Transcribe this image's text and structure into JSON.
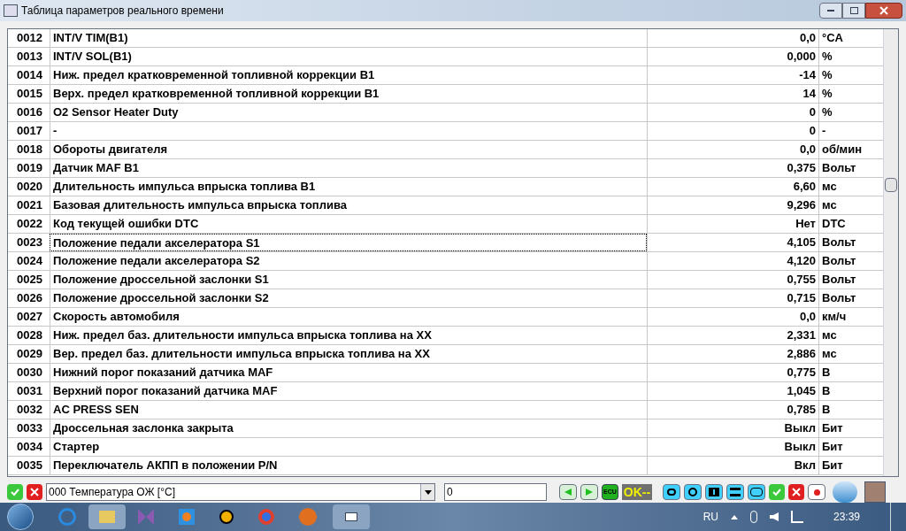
{
  "window": {
    "title": "Таблица параметров реального времени"
  },
  "table": {
    "rows": [
      {
        "id": "0012",
        "name": "INT/V TIM(B1)",
        "value": "0,0",
        "unit": "°CA",
        "focused": false
      },
      {
        "id": "0013",
        "name": "INT/V SOL(B1)",
        "value": "0,000",
        "unit": "%",
        "focused": false
      },
      {
        "id": "0014",
        "name": "Ниж. предел кратковременной топливной коррекции B1",
        "value": "-14",
        "unit": "%",
        "focused": false
      },
      {
        "id": "0015",
        "name": "Верх. предел кратковременной топливной коррекции B1",
        "value": "14",
        "unit": "%",
        "focused": false
      },
      {
        "id": "0016",
        "name": "O2 Sensor Heater Duty",
        "value": "0",
        "unit": "%",
        "focused": false
      },
      {
        "id": "0017",
        "name": "-",
        "value": "0",
        "unit": "-",
        "focused": false
      },
      {
        "id": "0018",
        "name": "Обороты двигателя",
        "value": "0,0",
        "unit": "об/мин",
        "focused": false
      },
      {
        "id": "0019",
        "name": "Датчик MAF B1",
        "value": "0,375",
        "unit": "Вольт",
        "focused": false
      },
      {
        "id": "0020",
        "name": "Длительность импульса впрыска топлива B1",
        "value": "6,60",
        "unit": "мс",
        "focused": false
      },
      {
        "id": "0021",
        "name": "Базовая длительность импульса впрыска топлива",
        "value": "9,296",
        "unit": "мс",
        "focused": false
      },
      {
        "id": "0022",
        "name": "Код текущей ошибки DTC",
        "value": "Нет",
        "unit": "DTC",
        "focused": false
      },
      {
        "id": "0023",
        "name": "Положение педали акселератора S1",
        "value": "4,105",
        "unit": "Вольт",
        "focused": true
      },
      {
        "id": "0024",
        "name": "Положение педали акселератора S2",
        "value": "4,120",
        "unit": "Вольт",
        "focused": false
      },
      {
        "id": "0025",
        "name": "Положение дроссельной заслонки S1",
        "value": "0,755",
        "unit": "Вольт",
        "focused": false
      },
      {
        "id": "0026",
        "name": "Положение дроссельной заслонки S2",
        "value": "0,715",
        "unit": "Вольт",
        "focused": false
      },
      {
        "id": "0027",
        "name": "Скорость автомобиля",
        "value": "0,0",
        "unit": "км/ч",
        "focused": false
      },
      {
        "id": "0028",
        "name": "Ниж. предел баз. длительности импульса впрыска топлива на ХХ",
        "value": "2,331",
        "unit": "мс",
        "focused": false
      },
      {
        "id": "0029",
        "name": "Вер. предел баз. длительности импульса впрыска топлива на ХХ",
        "value": "2,886",
        "unit": "мс",
        "focused": false
      },
      {
        "id": "0030",
        "name": "Нижний порог показаний датчика MAF",
        "value": "0,775",
        "unit": "В",
        "focused": false
      },
      {
        "id": "0031",
        "name": "Верхний порог показаний датчика MAF",
        "value": "1,045",
        "unit": "В",
        "focused": false
      },
      {
        "id": "0032",
        "name": "AC PRESS SEN",
        "value": "0,785",
        "unit": "В",
        "focused": false
      },
      {
        "id": "0033",
        "name": "Дроссельная заслонка закрыта",
        "value": "Выкл",
        "unit": "Бит",
        "focused": false
      },
      {
        "id": "0034",
        "name": "Стартер",
        "value": "Выкл",
        "unit": "Бит",
        "focused": false
      },
      {
        "id": "0035",
        "name": "Переключатель АКПП в положении P/N",
        "value": "Вкл",
        "unit": "Бит",
        "focused": false
      }
    ]
  },
  "toolbar": {
    "parameter_select": "000 Температура ОЖ [°C]",
    "value_field": "0",
    "ecu_label": "ECU",
    "status": "OK--"
  },
  "taskbar": {
    "language": "RU",
    "time": "23:39"
  }
}
